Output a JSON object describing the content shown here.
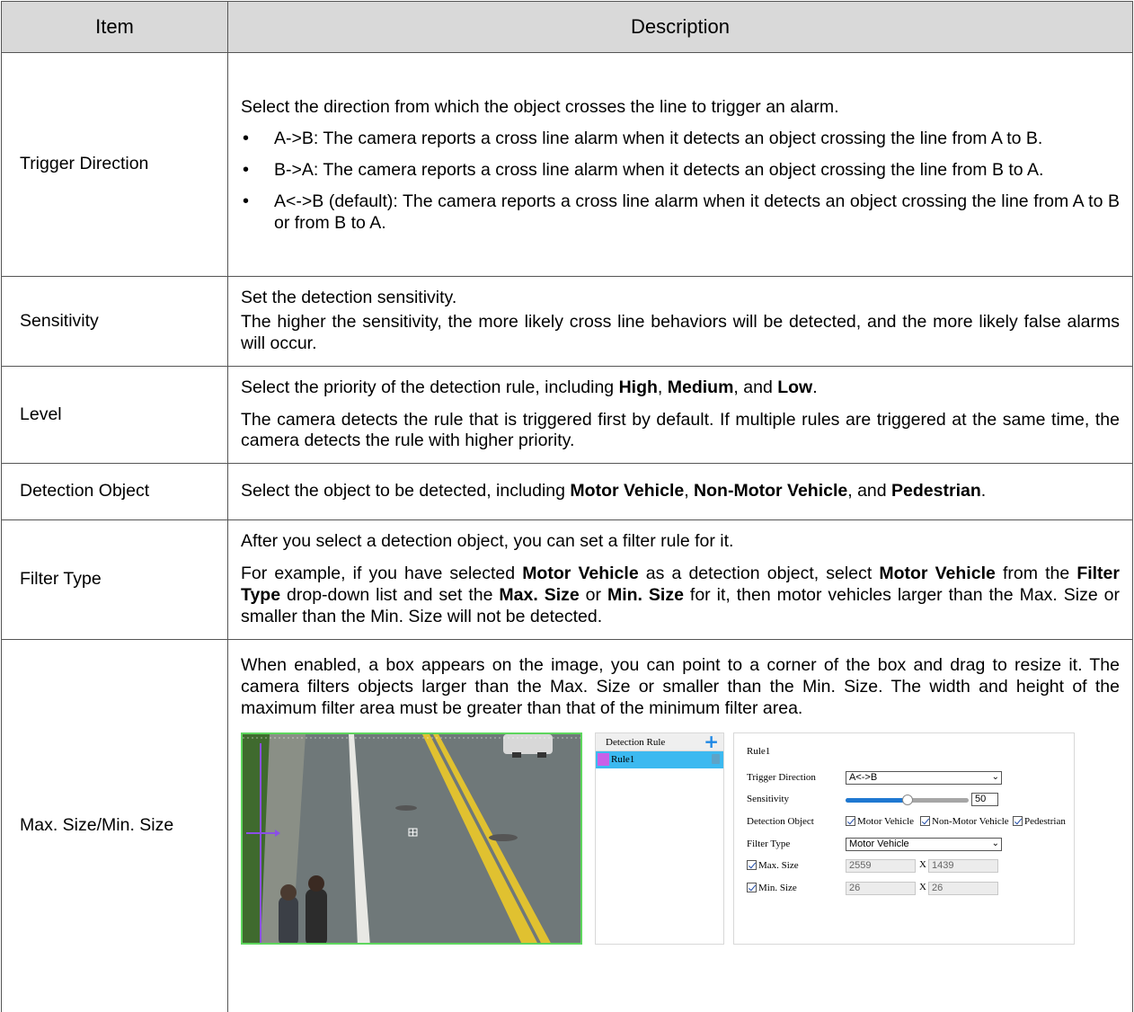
{
  "table": {
    "header": {
      "item": "Item",
      "description": "Description"
    },
    "rows": {
      "trigger": {
        "item": "Trigger Direction",
        "intro": "Select the direction from which the object crosses the line to trigger an alarm.",
        "bullets": [
          "A->B: The camera reports a cross line alarm when it detects an object crossing the line from A to B.",
          "B->A: The camera reports a cross line alarm when it detects an object crossing the line from B to A.",
          "A<->B (default): The camera reports a cross line alarm when it detects an object crossing the line from A to B or from B to A."
        ]
      },
      "sensitivity": {
        "item": "Sensitivity",
        "p1": "Set the detection sensitivity.",
        "p2": "The higher the sensitivity, the more likely cross line behaviors will be detected, and the more likely false alarms will occur."
      },
      "level": {
        "item": "Level",
        "p1a": "Select the priority of the detection rule, including ",
        "high": "High",
        "sep1": ", ",
        "medium": "Medium",
        "sep2": ", and ",
        "low": "Low",
        "end": ".",
        "p2": "The camera detects the rule that is triggered first by default. If multiple rules are triggered at the same time, the camera detects the rule with higher priority."
      },
      "detection_object": {
        "item": "Detection Object",
        "p1a": "Select the object to be detected, including ",
        "motor": "Motor Vehicle",
        "sep1": ", ",
        "nonmotor": "Non-Motor Vehicle",
        "sep2": ", and ",
        "pedestrian": "Pedestrian",
        "end": "."
      },
      "filter_type": {
        "item": "Filter Type",
        "p1": "After you select a detection object, you can set a filter rule for it.",
        "p2a": "For example, if you have selected ",
        "b1": "Motor Vehicle",
        "p2b": " as a detection object, select ",
        "b2": "Motor Vehicle",
        "p2c": " from the ",
        "b3": "Filter Type",
        "p2d": " drop-down list and set the ",
        "b4": "Max. Size",
        "p2e": " or ",
        "b5": "Min. Size",
        "p2f": " for it, then motor vehicles larger than the Max. Size or smaller than the Min. Size will not be detected."
      },
      "max_min": {
        "item": "Max. Size/Min. Size",
        "p1": "When enabled, a box appears on the image, you can point to a corner of the box and drag to resize it. The camera filters objects larger than the Max. Size or smaller than the Min. Size. The width and height of the maximum filter area must be greater than that of the minimum filter area."
      }
    }
  },
  "screenshot": {
    "rule_panel": {
      "title": "Detection Rule",
      "add_icon": "plus-icon",
      "rule_name": "Rule1",
      "delete_icon": "trash-icon"
    },
    "settings": {
      "rule_title": "Rule1",
      "trigger_direction_label": "Trigger Direction",
      "trigger_direction_value": "A<->B",
      "sensitivity_label": "Sensitivity",
      "sensitivity_value": "50",
      "sensitivity_fraction": 0.5,
      "detection_object_label": "Detection Object",
      "objects": [
        "Motor Vehicle",
        "Non-Motor Vehicle",
        "Pedestrian"
      ],
      "filter_type_label": "Filter Type",
      "filter_type_value": "Motor Vehicle",
      "max_size_label": "Max. Size",
      "max_w": "2559",
      "max_x": "X",
      "max_h": "1439",
      "min_size_label": "Min. Size",
      "min_w": "26",
      "min_x": "X",
      "min_h": "26"
    },
    "colors": {
      "accent": "#1e88e5",
      "selected_rule": "#3cb9f0",
      "rule_color": "#c860e8",
      "detect_box": "#5ed65e"
    }
  }
}
